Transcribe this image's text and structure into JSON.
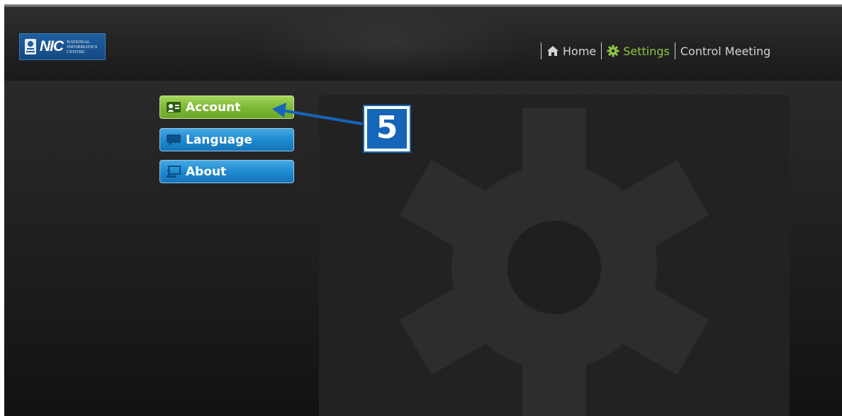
{
  "header": {
    "logo": {
      "mark": "NIC",
      "lines": [
        "NATIONAL",
        "INFORMATICS",
        "CENTRE"
      ]
    },
    "nav": [
      {
        "label": "Home",
        "icon": "home-icon"
      },
      {
        "label": "Settings",
        "icon": "gear-icon",
        "active": true
      },
      {
        "label": "Control Meeting"
      }
    ]
  },
  "sidebar": {
    "items": [
      {
        "label": "Account",
        "icon": "account-card-icon",
        "state": "selected",
        "color": "#7fb936"
      },
      {
        "label": "Language",
        "icon": "speech-bubble-icon",
        "color": "#1f8ad0"
      },
      {
        "label": "About",
        "icon": "presentation-icon",
        "color": "#1f8ad0"
      }
    ]
  },
  "annotation": {
    "callout_number": "5"
  },
  "colors": {
    "accent_green": "#8cc63f",
    "accent_blue": "#1565b8"
  }
}
